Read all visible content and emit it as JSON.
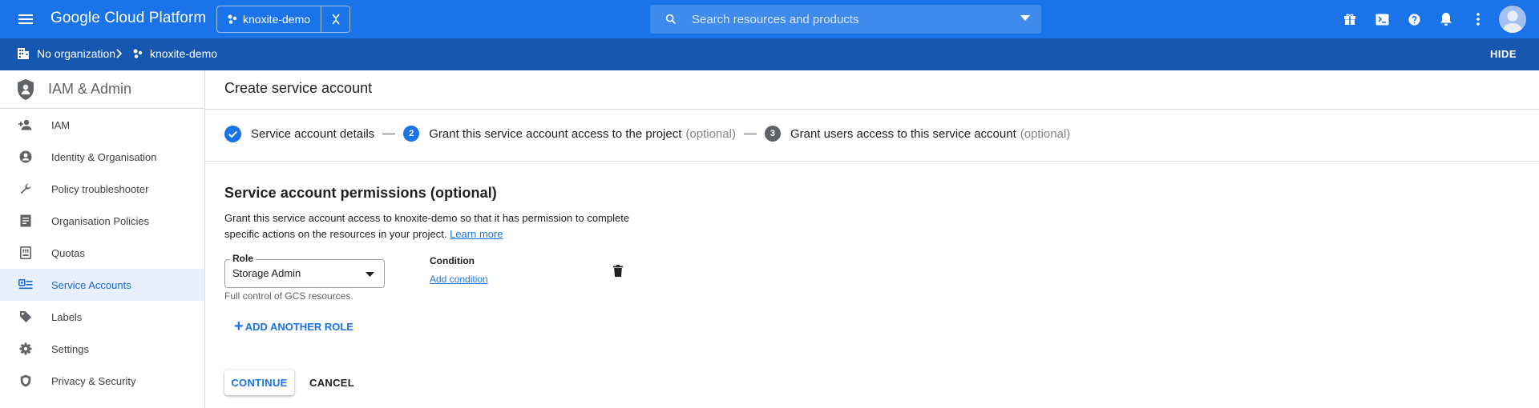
{
  "topbar": {
    "brand": "Google Cloud Platform",
    "project_name": "knoxite-demo",
    "search_placeholder": "Search resources and products",
    "accent_color": "#1a73e8"
  },
  "breadcrumb": {
    "organization": "No organization",
    "project": "knoxite-demo",
    "hide_label": "HIDE"
  },
  "sidebar": {
    "title": "IAM & Admin",
    "items": [
      {
        "label": "IAM",
        "icon": "person-add-icon"
      },
      {
        "label": "Identity & Organisation",
        "icon": "account-circle-icon"
      },
      {
        "label": "Policy troubleshooter",
        "icon": "wrench-icon"
      },
      {
        "label": "Organisation Policies",
        "icon": "document-icon"
      },
      {
        "label": "Quotas",
        "icon": "quota-icon"
      },
      {
        "label": "Service Accounts",
        "icon": "service-account-icon",
        "active": true
      },
      {
        "label": "Labels",
        "icon": "tag-icon"
      },
      {
        "label": "Settings",
        "icon": "gear-icon"
      },
      {
        "label": "Privacy & Security",
        "icon": "shield-icon"
      }
    ]
  },
  "main": {
    "page_title": "Create service account",
    "steps": [
      {
        "label": "Service account details",
        "number": "1",
        "state": "done"
      },
      {
        "label": "Grant this service account access to the project",
        "optional": "(optional)",
        "number": "2",
        "state": "active"
      },
      {
        "label": "Grant users access to this service account",
        "optional": "(optional)",
        "number": "3",
        "state": "pending"
      }
    ],
    "section_title": "Service account permissions (optional)",
    "description": "Grant this service account access to knoxite-demo so that it has permission to complete specific actions on the resources in your project.",
    "learn_more": "Learn more",
    "role_label": "Role",
    "role_value": "Storage Admin",
    "role_hint": "Full control of GCS resources.",
    "condition_label": "Condition",
    "add_condition": "Add condition",
    "add_another_role": "ADD ANOTHER ROLE",
    "continue_label": "CONTINUE",
    "cancel_label": "CANCEL"
  }
}
